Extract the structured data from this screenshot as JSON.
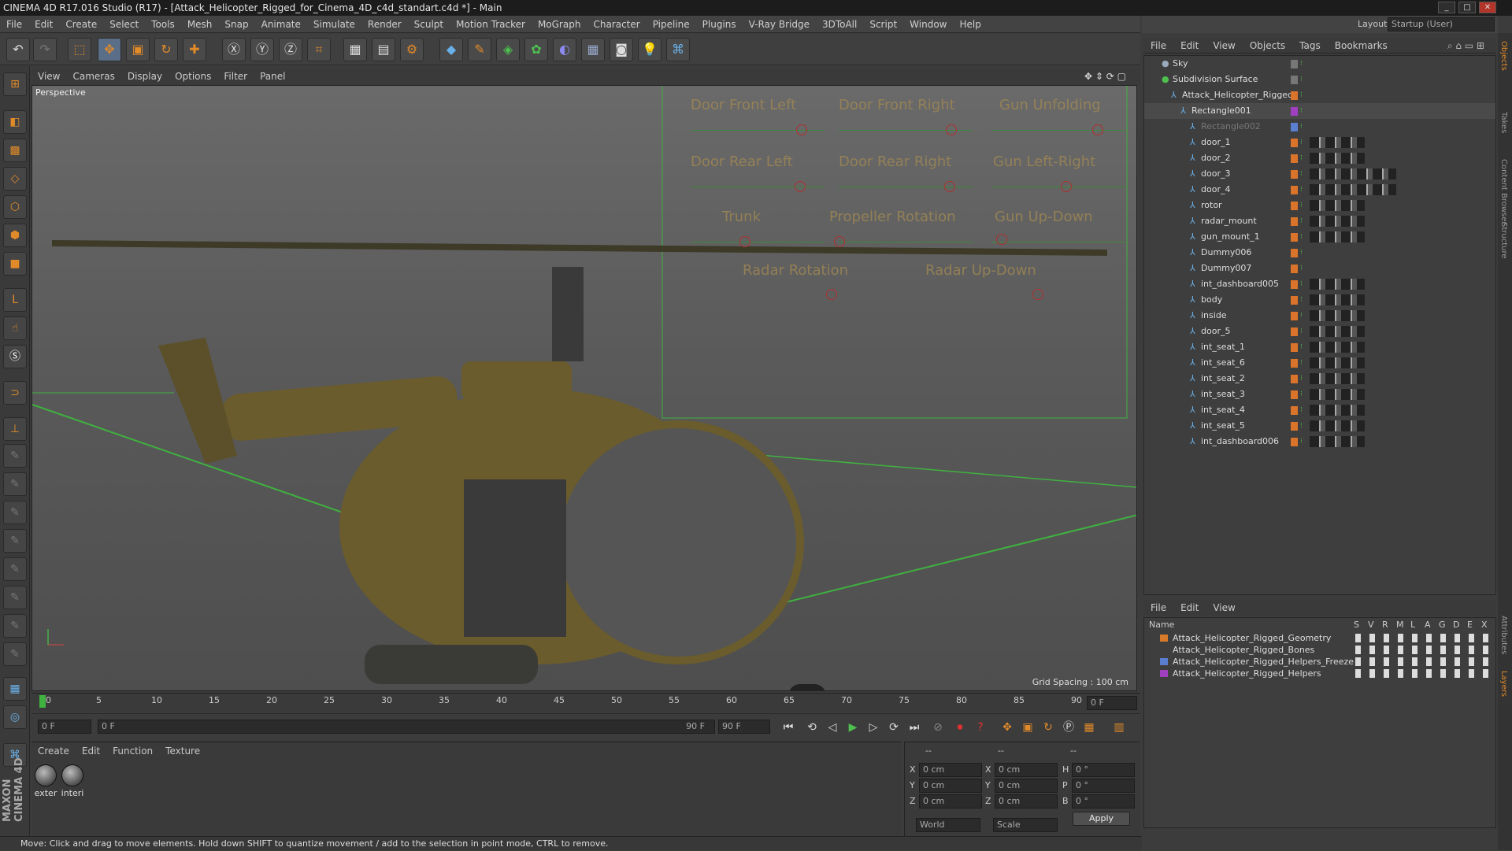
{
  "app": {
    "title": "CINEMA 4D R17.016 Studio (R17) - [Attack_Helicopter_Rigged_for_Cinema_4D_c4d_standart.c4d *] - Main",
    "layout_label": "Layout:",
    "layout_value": "Startup (User)"
  },
  "menubar": [
    "File",
    "Edit",
    "Create",
    "Select",
    "Tools",
    "Mesh",
    "Snap",
    "Animate",
    "Simulate",
    "Render",
    "Sculpt",
    "Motion Tracker",
    "MoGraph",
    "Character",
    "Pipeline",
    "Plugins",
    "V-Ray Bridge",
    "3DToAll",
    "Script",
    "Window",
    "Help"
  ],
  "viewport": {
    "menu": [
      "View",
      "Cameras",
      "Display",
      "Options",
      "Filter",
      "Panel"
    ],
    "camera_label": "Perspective",
    "grid_spacing": "Grid Spacing : 100 cm",
    "rig_controls": [
      "Door Front Left",
      "Door Front Right",
      "Gun Unfolding",
      "Door Rear Left",
      "Door Rear Right",
      "Gun Left-Right",
      "Trunk",
      "Propeller Rotation",
      "Gun Up-Down",
      "Radar Rotation",
      "Radar Up-Down"
    ]
  },
  "timeline": {
    "ticks": [
      "0",
      "5",
      "10",
      "15",
      "20",
      "25",
      "30",
      "35",
      "40",
      "45",
      "50",
      "55",
      "60",
      "65",
      "70",
      "75",
      "80",
      "85",
      "90"
    ],
    "current_frame_right": "0 F",
    "start_frame": "0 F",
    "range_start": "0 F",
    "range_end": "90 F",
    "end_frame": "90 F"
  },
  "material_manager": {
    "menu": [
      "Create",
      "Edit",
      "Function",
      "Texture"
    ],
    "materials": [
      "exter",
      "interi"
    ]
  },
  "coordinates": {
    "header": [
      "--",
      "--",
      "--"
    ],
    "rows": [
      {
        "a": "X",
        "av": "0 cm",
        "b": "X",
        "bv": "0 cm",
        "c": "H",
        "cv": "0 °"
      },
      {
        "a": "Y",
        "av": "0 cm",
        "b": "Y",
        "bv": "0 cm",
        "c": "P",
        "cv": "0 °"
      },
      {
        "a": "Z",
        "av": "0 cm",
        "b": "Z",
        "bv": "0 cm",
        "c": "B",
        "cv": "0 °"
      }
    ],
    "mode_world": "World",
    "mode_scale": "Scale",
    "apply": "Apply"
  },
  "status": "Move: Click and drag to move elements. Hold down SHIFT to quantize movement / add to the selection in point mode, CTRL to remove.",
  "object_manager": {
    "menu": [
      "File",
      "Edit",
      "View",
      "Objects",
      "Tags",
      "Bookmarks"
    ],
    "objects": [
      {
        "name": "Sky",
        "indent": 0
      },
      {
        "name": "Subdivision Surface",
        "indent": 0
      },
      {
        "name": "Attack_Helicopter_Rigged",
        "indent": 1
      },
      {
        "name": "Rectangle001",
        "indent": 2
      },
      {
        "name": "Rectangle002",
        "indent": 3
      },
      {
        "name": "door_1",
        "indent": 3
      },
      {
        "name": "door_2",
        "indent": 3
      },
      {
        "name": "door_3",
        "indent": 3
      },
      {
        "name": "door_4",
        "indent": 3
      },
      {
        "name": "rotor",
        "indent": 3
      },
      {
        "name": "radar_mount",
        "indent": 3
      },
      {
        "name": "gun_mount_1",
        "indent": 3
      },
      {
        "name": "Dummy006",
        "indent": 3
      },
      {
        "name": "Dummy007",
        "indent": 3
      },
      {
        "name": "int_dashboard005",
        "indent": 3
      },
      {
        "name": "body",
        "indent": 3
      },
      {
        "name": "inside",
        "indent": 3
      },
      {
        "name": "door_5",
        "indent": 3
      },
      {
        "name": "int_seat_1",
        "indent": 3
      },
      {
        "name": "int_seat_6",
        "indent": 3
      },
      {
        "name": "int_seat_2",
        "indent": 3
      },
      {
        "name": "int_seat_3",
        "indent": 3
      },
      {
        "name": "int_seat_4",
        "indent": 3
      },
      {
        "name": "int_seat_5",
        "indent": 3
      },
      {
        "name": "int_dashboard006",
        "indent": 3
      }
    ]
  },
  "layer_manager": {
    "menu": [
      "File",
      "Edit",
      "View"
    ],
    "columns": [
      "Name",
      "S",
      "V",
      "R",
      "M",
      "L",
      "A",
      "G",
      "D",
      "E",
      "X"
    ],
    "layers": [
      {
        "name": "Attack_Helicopter_Rigged_Geometry",
        "color": "#d87a2a"
      },
      {
        "name": "Attack_Helicopter_Rigged_Bones",
        "color": "#3e3e3e"
      },
      {
        "name": "Attack_Helicopter_Rigged_Helpers_Freeze",
        "color": "#5a7fd0"
      },
      {
        "name": "Attack_Helicopter_Rigged_Helpers",
        "color": "#a040c0"
      }
    ]
  },
  "side_tabs": [
    "Objects",
    "Takes",
    "Content Browser",
    "Structure",
    "Attributes",
    "Layers"
  ]
}
